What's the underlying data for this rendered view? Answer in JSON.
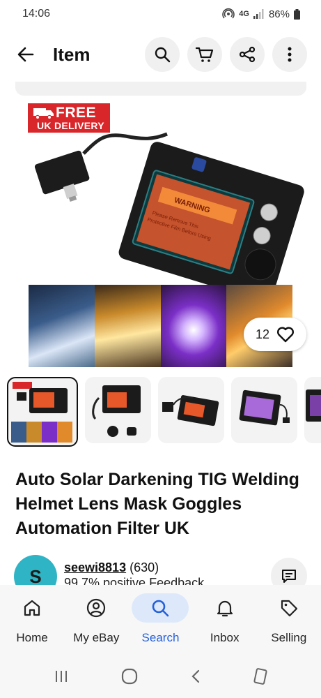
{
  "status": {
    "time": "14:06",
    "network": "4G",
    "battery": "86%"
  },
  "header": {
    "title": "Item"
  },
  "hero": {
    "badge_line1": "FREE",
    "badge_line2": "UK DELIVERY",
    "warning_title": "WARNING",
    "warning_text": "Please Remove This Protective Film Before Using",
    "likes": "12"
  },
  "thumbnails": [
    "thumb-1",
    "thumb-2",
    "thumb-3",
    "thumb-4",
    "thumb-5"
  ],
  "item": {
    "title": "Auto Solar Darkening TIG Welding Helmet Lens Mask Goggles Automation Filter UK"
  },
  "seller": {
    "avatar_letter": "S",
    "username": "seewi8813",
    "score": "(630)",
    "feedback": "99.7% positive Feedback"
  },
  "nav": {
    "items": [
      {
        "label": "Home"
      },
      {
        "label": "My eBay"
      },
      {
        "label": "Search"
      },
      {
        "label": "Inbox"
      },
      {
        "label": "Selling"
      }
    ],
    "active_color": "#2460d8"
  }
}
